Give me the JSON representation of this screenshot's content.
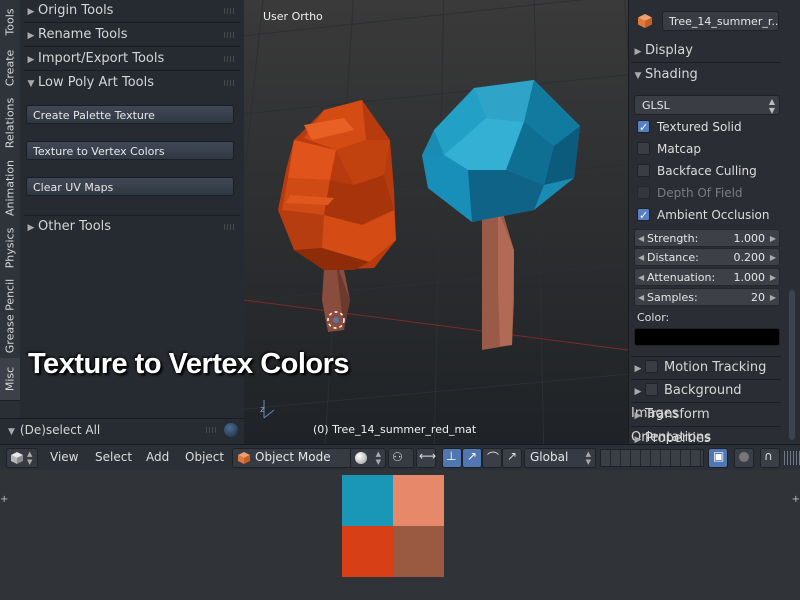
{
  "vertical_tabs": [
    "Tools",
    "Create",
    "Relations",
    "Animation",
    "Physics",
    "Grease Pencil",
    "Misc"
  ],
  "tool_shelf": {
    "panels": [
      {
        "label": "Origin Tools",
        "expanded": false
      },
      {
        "label": "Rename Tools",
        "expanded": false
      },
      {
        "label": "Import/Export Tools",
        "expanded": false
      },
      {
        "label": "Low Poly Art Tools",
        "expanded": true
      }
    ],
    "buttons": [
      "Create Palette Texture",
      "Texture to Vertex Colors",
      "Clear UV Maps"
    ],
    "other_panel": "Other Tools",
    "deselect_label": "(De)select All"
  },
  "viewport": {
    "view_label": "User Ortho",
    "object_label": "(0) Tree_14_summer_red_mat"
  },
  "caption": "Texture to Vertex Colors",
  "properties": {
    "object_name": "Tree_14_summer_r...",
    "display_label": "Display",
    "shading_label": "Shading",
    "shading_mode": "GLSL",
    "checks": [
      {
        "label": "Textured Solid",
        "checked": true,
        "enabled": true
      },
      {
        "label": "Matcap",
        "checked": false,
        "enabled": true
      },
      {
        "label": "Backface Culling",
        "checked": false,
        "enabled": true
      },
      {
        "label": "Depth Of Field",
        "checked": false,
        "enabled": false
      },
      {
        "label": "Ambient Occlusion",
        "checked": true,
        "enabled": true
      }
    ],
    "ao_fields": [
      {
        "name": "Strength:",
        "value": "1.000"
      },
      {
        "name": "Distance:",
        "value": "0.200"
      },
      {
        "name": "Attenuation:",
        "value": "1.000"
      },
      {
        "name": "Samples:",
        "value": "20"
      }
    ],
    "color_label": "Color:",
    "collapsed_sections": [
      "Motion Tracking",
      "Background Images",
      "Transform Orientations",
      "Properties"
    ]
  },
  "header": {
    "menus": [
      "View",
      "Select",
      "Add",
      "Object"
    ],
    "mode": "Object Mode",
    "orientation": "Global"
  },
  "palette": {
    "colors": [
      "#1a96b6",
      "#e8886a",
      "#d74016",
      "#9a5a42"
    ]
  },
  "colors": {
    "accent": "#5680c2",
    "tree_orange": "#c8410f",
    "tree_blue": "#1a8cb4"
  }
}
